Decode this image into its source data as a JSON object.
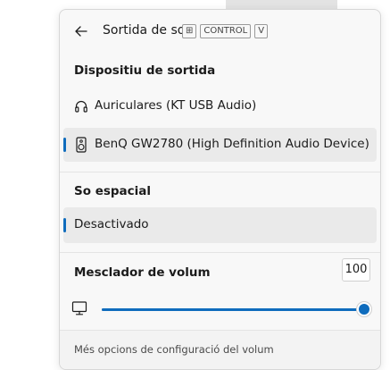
{
  "header": {
    "title": "Sortida de so",
    "back_icon": "back-arrow-icon",
    "shortcut_keys": [
      "⊞",
      "CONTROL",
      "V"
    ]
  },
  "output_section": {
    "heading": "Dispositiu de sortida",
    "devices": [
      {
        "label": "Auriculares (KT USB Audio)",
        "icon": "headphones-icon",
        "selected": false
      },
      {
        "label": "BenQ GW2780 (High Definition Audio Device)",
        "icon": "speaker-icon",
        "selected": true
      }
    ]
  },
  "spatial_section": {
    "heading": "So espacial",
    "selected_option": "Desactivado"
  },
  "volume_section": {
    "heading": "Mesclador de volum",
    "value": "100",
    "level_percent": 100,
    "device_icon": "monitor-icon"
  },
  "footer": {
    "link": "Més opcions de configuració del volum"
  },
  "colors": {
    "accent": "#0f6cbd",
    "panel_bg": "#f8f8f8",
    "selected_bg": "#eaeaea"
  }
}
